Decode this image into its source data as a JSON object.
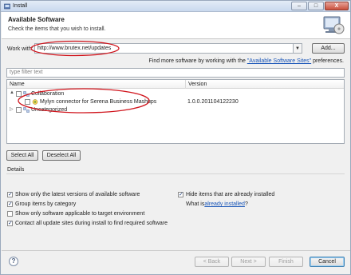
{
  "window": {
    "title": "Install",
    "controls": {
      "minimize": "–",
      "maximize": "□",
      "close": "X"
    }
  },
  "banner": {
    "title": "Available Software",
    "subtitle": "Check the items that you wish to install."
  },
  "work_with": {
    "label": "Work with:",
    "value": "http://www.brutex.net/updates",
    "add_button": "Add...",
    "find_more_prefix": "Find more software by working with the ",
    "find_more_link": "\"Available Software Sites\"",
    "find_more_suffix": " preferences."
  },
  "filter": {
    "placeholder": "type filter text"
  },
  "tree": {
    "columns": {
      "name": "Name",
      "version": "Version"
    },
    "rows": [
      {
        "label": "Collaboration",
        "expander": "▲",
        "version": ""
      },
      {
        "label": "Mylyn connector for Serena Business Mashups",
        "version": "1.0.0.201104122230"
      },
      {
        "label": "Uncategorized",
        "expander": "▷",
        "version": ""
      }
    ]
  },
  "selection_buttons": {
    "select_all": "Select All",
    "deselect_all": "Deselect All"
  },
  "details": {
    "label": "Details"
  },
  "options": {
    "latest_versions": {
      "label": "Show only the latest versions of available software",
      "checked": true
    },
    "group_by_category": {
      "label": "Group items by category",
      "checked": true
    },
    "target_env": {
      "label": "Show only software applicable to target environment",
      "checked": false
    },
    "contact_sites": {
      "label": "Contact all update sites during install to find required software",
      "checked": true
    },
    "hide_installed": {
      "label": "Hide items that are already installed",
      "checked": true
    },
    "what_is_prefix": "What is ",
    "what_is_link": "already installed",
    "what_is_suffix": "?"
  },
  "footer": {
    "help": "?",
    "back": "< Back",
    "next": "Next >",
    "finish": "Finish",
    "cancel": "Cancel"
  },
  "colors": {
    "highlight_ellipse": "#d0141c",
    "link": "#1a56b8"
  }
}
